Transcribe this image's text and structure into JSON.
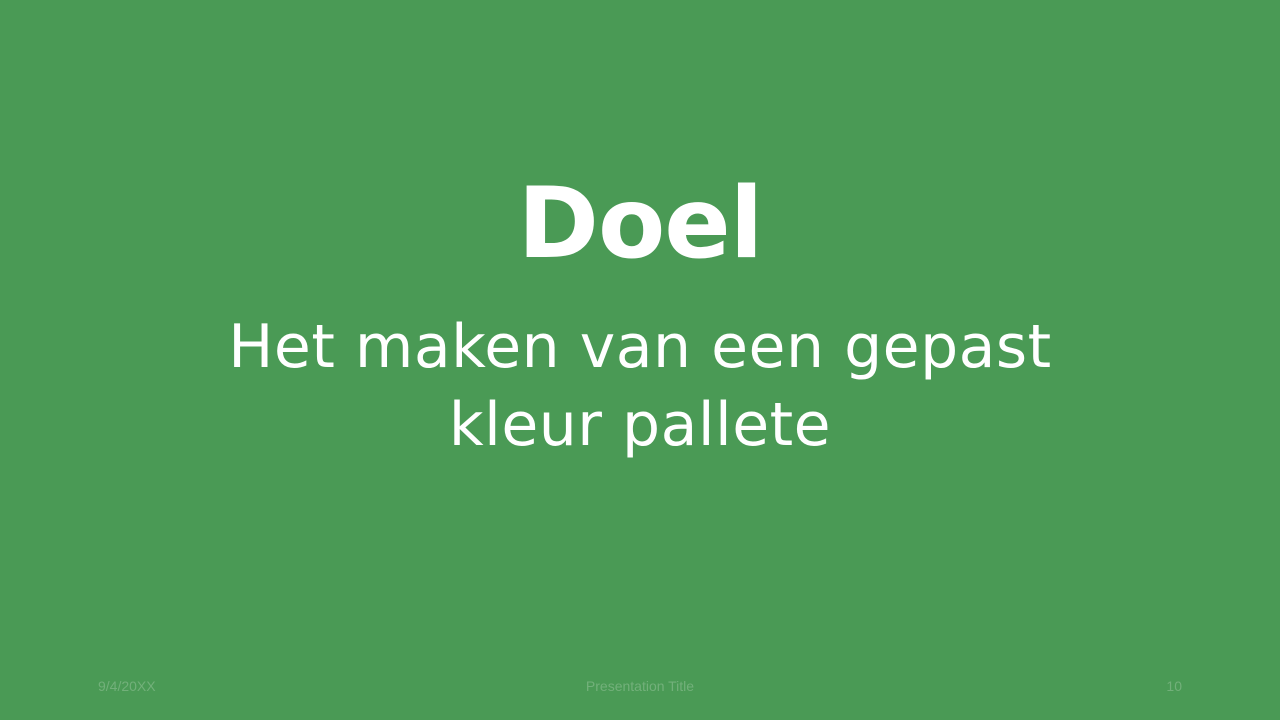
{
  "slide": {
    "title": "Doel",
    "subtitle_lines": [
      "Het maken van een gepast",
      "kleur pallete"
    ],
    "background_color": "#4a9a55",
    "text_color": "#ffffff"
  },
  "footer": {
    "date": "9/4/20XX",
    "presentation_title": "Presentation Title",
    "page_number": "10"
  }
}
